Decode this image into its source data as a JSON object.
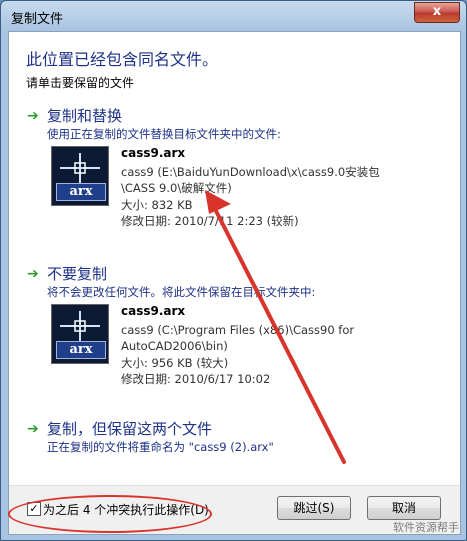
{
  "window": {
    "title": "复制文件",
    "close_glyph": "x"
  },
  "heading": "此位置已经包含同名文件。",
  "subheading": "请单击要保留的文件",
  "options": [
    {
      "title": "复制和替换",
      "description": "使用正在复制的文件替换目标文件夹中的文件:",
      "file": {
        "name": "cass9.arx",
        "path": "cass9 (E:\\BaiduYunDownload\\x\\cass9.0安装包\\CASS 9.0\\破解文件)",
        "size": "大小: 832 KB",
        "modified": "修改日期: 2010/7/11 2:23 (较新)"
      }
    },
    {
      "title": "不要复制",
      "description": "将不会更改任何文件。将此文件保留在目标文件夹中:",
      "file": {
        "name": "cass9.arx",
        "path": "cass9 (C:\\Program Files (x86)\\Cass90 for AutoCAD2006\\bin)",
        "size": "大小: 956 KB (较大)",
        "modified": "修改日期: 2010/6/17 10:02"
      }
    },
    {
      "title": "复制，但保留这两个文件",
      "description": "正在复制的文件将重命名为 \"cass9 (2).arx\""
    }
  ],
  "footer": {
    "checkbox_label": "为之后 4 个冲突执行此操作(D)",
    "checkbox_checked": true,
    "skip_label": "跳过(S)",
    "cancel_label": "取消"
  },
  "file_icon_badge": "arx",
  "watermark": "软件资源帮手",
  "colors": {
    "accent": "#1e3287",
    "annotation": "#d9342b",
    "arrow": "#2d9b2d"
  }
}
